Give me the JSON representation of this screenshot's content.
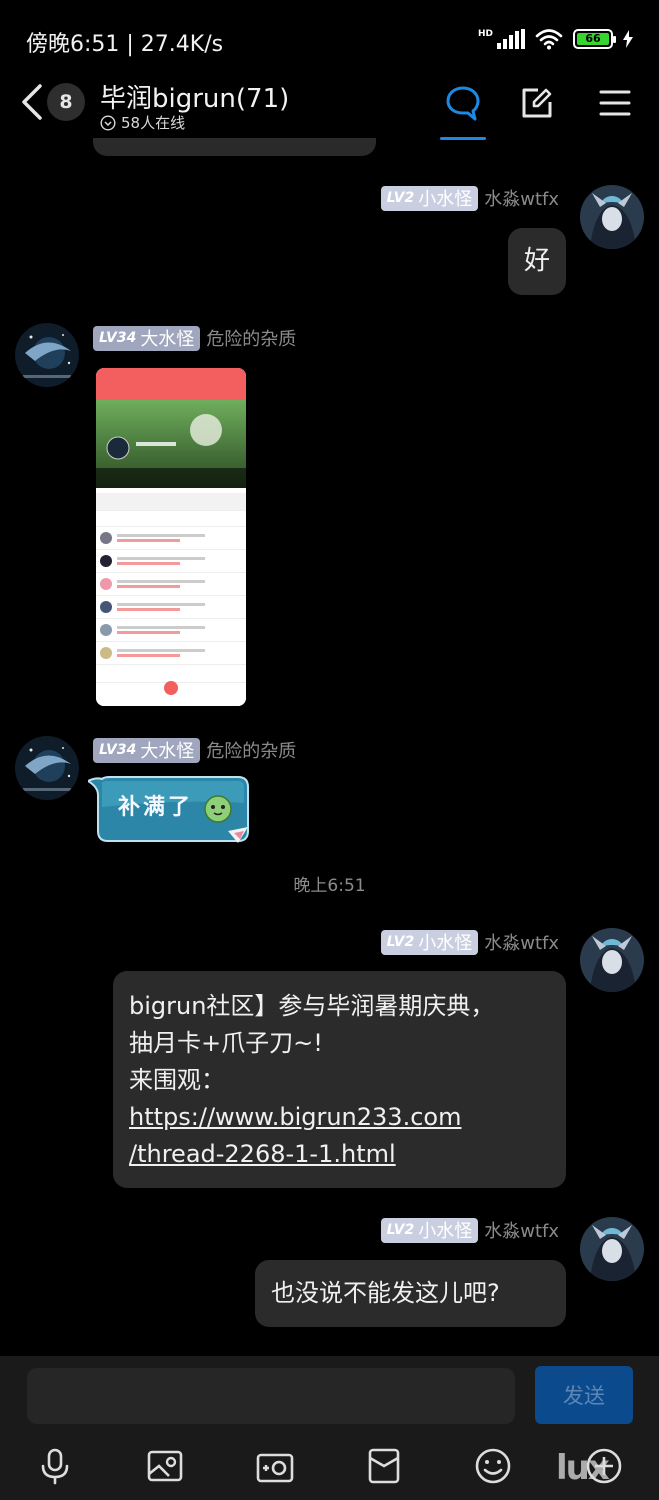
{
  "status_bar": {
    "time_speed": "傍晚6:51 | 27.4K/s",
    "network_tag": "HD",
    "battery_level": "66"
  },
  "header": {
    "unread_count": "8",
    "group_title": "毕润bigrun(71)",
    "online_text": "58人在线"
  },
  "messages": [
    {
      "level": "LV2",
      "rank": "小水怪",
      "nick": "水淼wtfx",
      "text": "好"
    },
    {
      "level": "LV34",
      "rank": "大水怪",
      "nick": "危险的杂质"
    },
    {
      "level": "LV34",
      "rank": "大水怪",
      "nick": "危险的杂质",
      "sticker_text": "补满了"
    },
    {
      "level": "LV2",
      "rank": "小水怪",
      "nick": "水淼wtfx",
      "line1": "bigrun社区】参与毕润暑期庆典，",
      "line2": "抽月卡+爪子刀~!",
      "line3": "来围观：",
      "link1": "https://www.bigrun233.com",
      "link2": "/thread-2268-1-1.html"
    },
    {
      "level": "LV2",
      "rank": "小水怪",
      "nick": "水淼wtfx",
      "text": "也没说不能发这儿吧?"
    }
  ],
  "timestamp": "晚上6:51",
  "input": {
    "value": "",
    "send_label": "发送"
  },
  "watermark": "lux"
}
